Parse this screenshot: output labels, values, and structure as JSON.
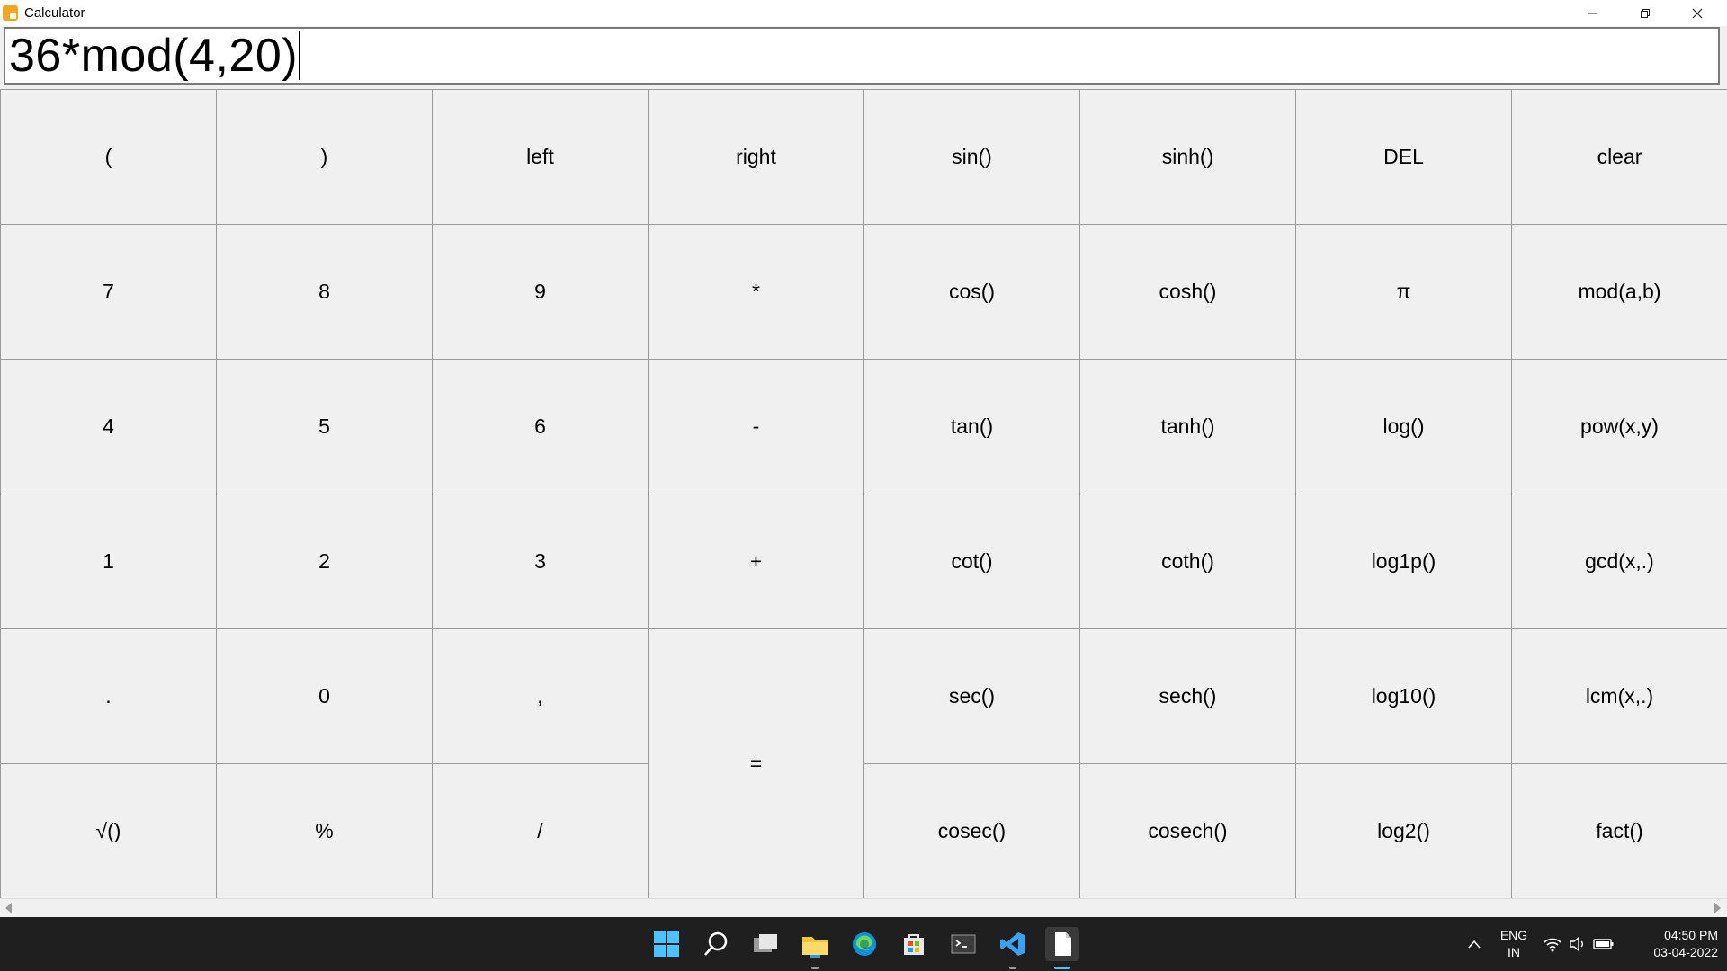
{
  "window": {
    "title": "Calculator",
    "controls": [
      "minimize",
      "restore",
      "close"
    ]
  },
  "display": {
    "expression": "36*mod(4,20)"
  },
  "keys": {
    "open_paren": "(",
    "close_paren": ")",
    "left": "left",
    "right": "right",
    "sin": "sin()",
    "sinh": "sinh()",
    "del": "DEL",
    "clear": "clear",
    "seven": "7",
    "eight": "8",
    "nine": "9",
    "multiply": "*",
    "cos": "cos()",
    "cosh": "cosh()",
    "pi": "π",
    "mod": "mod(a,b)",
    "four": "4",
    "five": "5",
    "six": "6",
    "minus": "-",
    "tan": "tan()",
    "tanh": "tanh()",
    "log": "log()",
    "pow": "pow(x,y)",
    "one": "1",
    "two": "2",
    "three": "3",
    "plus": "+",
    "cot": "cot()",
    "coth": "coth()",
    "log1p": "log1p()",
    "gcd": "gcd(x,.)",
    "dot": ".",
    "zero": "0",
    "comma": ",",
    "equals": "=",
    "sec": "sec()",
    "sech": "sech()",
    "log10": "log10()",
    "lcm": "lcm(x,.)",
    "sqrt": "√()",
    "percent": "%",
    "divide": "/",
    "cosec": "cosec()",
    "cosech": "cosech()",
    "log2": "log2()",
    "fact": "fact()"
  },
  "taskbar": {
    "icons": [
      "windows-start",
      "search",
      "task-view",
      "file-explorer",
      "edge",
      "microsoft-store",
      "terminal",
      "vscode",
      "notepad"
    ],
    "language": "ENG",
    "region": "IN",
    "time": "04:50 PM",
    "date": "03-04-2022"
  },
  "colors": {
    "key_background": "#f0f0f0",
    "key_border": "#9a9a9a",
    "taskbar": "#1f1f1f",
    "app_icon": "#f4a623"
  }
}
